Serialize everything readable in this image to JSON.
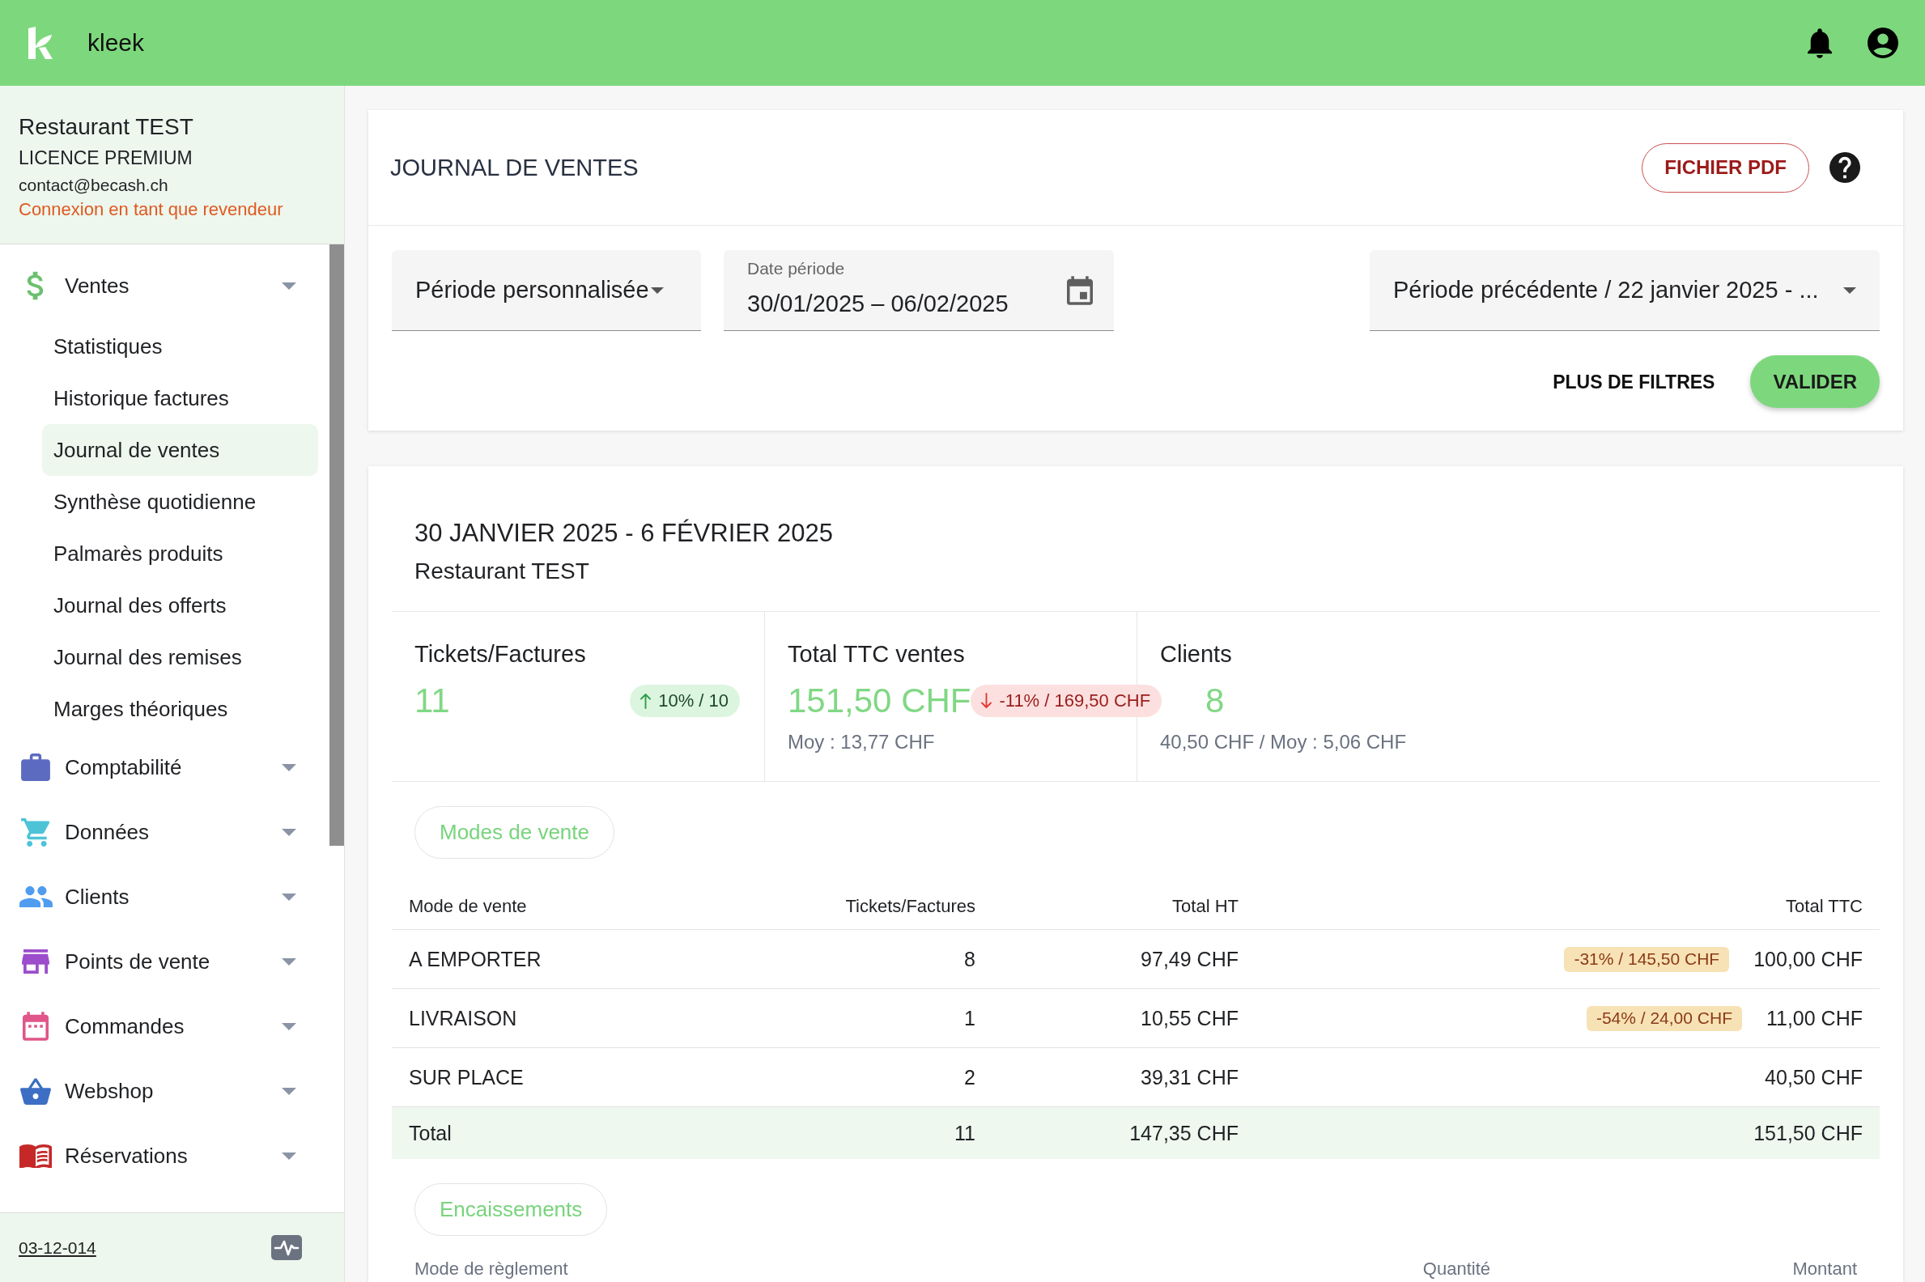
{
  "header": {
    "brand": "kleek"
  },
  "account": {
    "name": "Restaurant TEST",
    "license": "LICENCE PREMIUM",
    "email": "contact@becash.ch",
    "notice": "Connexion en tant que revendeur"
  },
  "nav": [
    {
      "label": "Ventes",
      "children": [
        {
          "label": "Statistiques",
          "selected": false
        },
        {
          "label": "Historique factures",
          "selected": false
        },
        {
          "label": "Journal de ventes",
          "selected": true
        },
        {
          "label": "Synthèse quotidienne",
          "selected": false
        },
        {
          "label": "Palmarès produits",
          "selected": false
        },
        {
          "label": "Journal des offerts",
          "selected": false
        },
        {
          "label": "Journal des remises",
          "selected": false
        },
        {
          "label": "Marges théoriques",
          "selected": false
        }
      ]
    },
    {
      "label": "Comptabilité"
    },
    {
      "label": "Données"
    },
    {
      "label": "Clients"
    },
    {
      "label": "Points de vente"
    },
    {
      "label": "Commandes"
    },
    {
      "label": "Webshop"
    },
    {
      "label": "Réservations"
    }
  ],
  "footer": {
    "version": "03-12-014"
  },
  "page": {
    "title": "JOURNAL DE VENTES",
    "pdf_button": "FICHIER PDF"
  },
  "filters": {
    "period_select": "Période personnalisée",
    "date_field": {
      "label": "Date période",
      "value": "30/01/2025 – 06/02/2025"
    },
    "compare_select": "Période précédente / 22 janvier 2025 - ...",
    "buttons": [
      {
        "label": "PLUS DE FILTRES",
        "kind": "text"
      },
      {
        "label": "VALIDER",
        "kind": "primary"
      }
    ]
  },
  "report": {
    "title": "30 JANVIER 2025 - 6 FÉVRIER 2025",
    "subtitle": "Restaurant TEST",
    "kpis": [
      {
        "label": "Tickets/Factures",
        "value": "11",
        "badge": {
          "kind": "up",
          "text": "10% / 10"
        }
      },
      {
        "label": "Total TTC ventes",
        "value": "151,50 CHF",
        "badge": {
          "kind": "down",
          "text": "-11% / 169,50 CHF"
        },
        "note": "Moy : 13,77 CHF"
      },
      {
        "label": "Clients",
        "value": "8",
        "note": "40,50 CHF / Moy : 5,06 CHF"
      }
    ]
  },
  "sales_modes": {
    "chip": "Modes de vente",
    "columns": [
      "Mode de vente",
      "Tickets/Factures",
      "Total HT",
      "Total TTC"
    ],
    "rows": [
      {
        "cells": [
          "A EMPORTER",
          "8",
          "97,49 CHF",
          "100,00 CHF"
        ],
        "badge": "-31% / 145,50 CHF"
      },
      {
        "cells": [
          "LIVRAISON",
          "1",
          "10,55 CHF",
          "11,00 CHF"
        ],
        "badge": "-54% / 24,00 CHF"
      },
      {
        "cells": [
          "SUR PLACE",
          "2",
          "39,31 CHF",
          "40,50 CHF"
        ]
      }
    ],
    "total": [
      "Total",
      "11",
      "147,35 CHF",
      "151,50 CHF"
    ]
  },
  "payments": {
    "chip": "Encaissements",
    "columns": [
      "Mode de règlement",
      "Quantité",
      "Montant"
    ]
  }
}
